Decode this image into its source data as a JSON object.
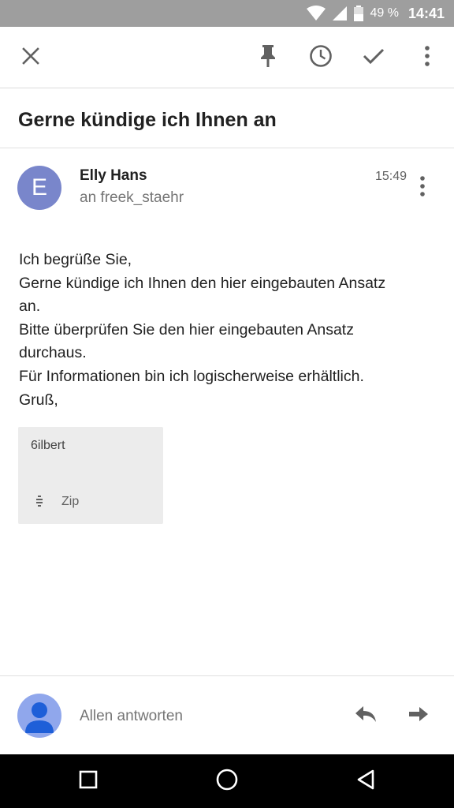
{
  "status_bar": {
    "battery_text": "49 %",
    "time": "14:41",
    "icons": [
      "wifi-icon",
      "cell-signal-icon",
      "battery-icon"
    ]
  },
  "toolbar": {
    "icons": [
      "close-icon",
      "pin-icon",
      "snooze-clock-icon",
      "done-check-icon",
      "more-vert-icon"
    ]
  },
  "email": {
    "subject": "Gerne kündige ich Ihnen an",
    "sender": {
      "avatar_letter": "E",
      "avatar_color": "#7986cb",
      "name": "Elly Hans",
      "recipient_line": "an freek_staehr",
      "time": "15:49"
    },
    "body_lines": [
      "Ich begrüße Sie,",
      "Gerne kündige ich Ihnen den hier eingebauten Ansatz",
      "an.",
      "Bitte überprüfen Sie den hier eingebauten Ansatz",
      "durchaus.",
      "Für Informationen bin ich logischerweise erhältlich.",
      "Gruß,"
    ],
    "attachment": {
      "name": "6ilbert",
      "type": "Zip",
      "icon": "zip-file-icon"
    }
  },
  "reply_bar": {
    "label": "Allen antworten",
    "avatar_color": "#90a7ec",
    "icons": [
      "reply-icon",
      "forward-icon"
    ]
  },
  "nav_bar": {
    "icons": [
      "recents-square-icon",
      "home-circle-icon",
      "back-triangle-icon"
    ]
  }
}
